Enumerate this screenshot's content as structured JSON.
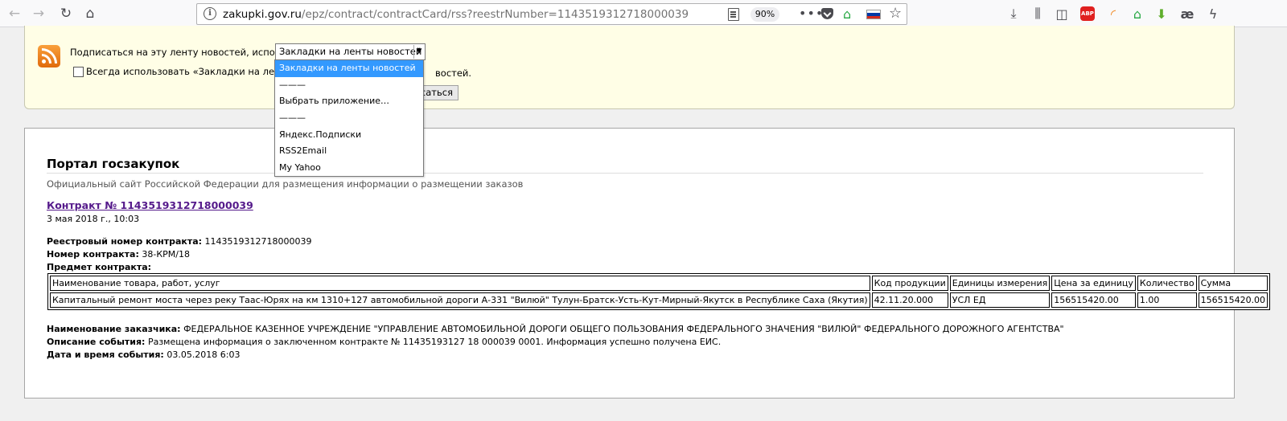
{
  "browser": {
    "url_host": "zakupki.gov.ru",
    "url_path": "/epz/contract/contractCard/rss?reestrNumber=1143519312718000039",
    "zoom": "90%",
    "flag_colors": [
      "#ffffff",
      "#0039a6",
      "#d52b1e"
    ],
    "abp_label": "ABP",
    "ae_label": "æ"
  },
  "subscribe": {
    "label": "Подписаться на эту ленту новостей, используя",
    "selected_option": "Закладки на ленты новостей",
    "always_text": "Всегда использовать «Закладки на ленты но",
    "always_tail": "востей.",
    "button_label": "асаться",
    "dropdown_options": [
      "Закладки на ленты новостей",
      "———",
      "Выбрать приложение…",
      "———",
      "Яндекс.Подписки",
      "RSS2Email",
      "My Yahoo"
    ]
  },
  "feed": {
    "title": "Портал госзакупок",
    "subtitle": "Официальный сайт Российской Федерации для размещения информации о размещении заказов",
    "entry_title": "Контракт № 1143519312718000039",
    "entry_date": "3 мая 2018 г., 10:03",
    "reg_number_label": "Реестровый номер контракта:",
    "reg_number_value": " 1143519312718000039",
    "contract_number_label": "Номер контракта:",
    "contract_number_value": " 38-КРМ/18",
    "subject_label": "Предмет контракта:",
    "table": {
      "headers": [
        "Наименование товара, работ, услуг",
        "Код продукции",
        "Единицы измерения",
        "Цена за единицу",
        "Количество",
        "Сумма"
      ],
      "rows": [
        [
          "Капитальный ремонт моста через реку Таас-Юрях на км 1310+127 автомобильной дороги А-331 \"Вилюй\" Тулун-Братск-Усть-Кут-Мирный-Якутск в Республике Саха (Якутия)",
          "42.11.20.000",
          "УСЛ ЕД",
          "156515420.00",
          "1.00",
          "156515420.00"
        ]
      ]
    },
    "customer_label": "Наименование заказчика:",
    "customer_value": " ФЕДЕРАЛЬНОЕ КАЗЕННОЕ УЧРЕЖДЕНИЕ \"УПРАВЛЕНИЕ АВТОМОБИЛЬНОЙ ДОРОГИ ОБЩЕГО ПОЛЬЗОВАНИЯ ФЕДЕРАЛЬНОГО ЗНАЧЕНИЯ \"ВИЛЮЙ\" ФЕДЕРАЛЬНОГО ДОРОЖНОГО АГЕНТСТВА\"",
    "event_desc_label": "Описание события:",
    "event_desc_value": " Размещена информация о заключенном контракте № 11435193127 18 000039 0001. Информация успешно получена ЕИС.",
    "event_time_label": "Дата и время события:",
    "event_time_value": " 03.05.2018 6:03"
  }
}
